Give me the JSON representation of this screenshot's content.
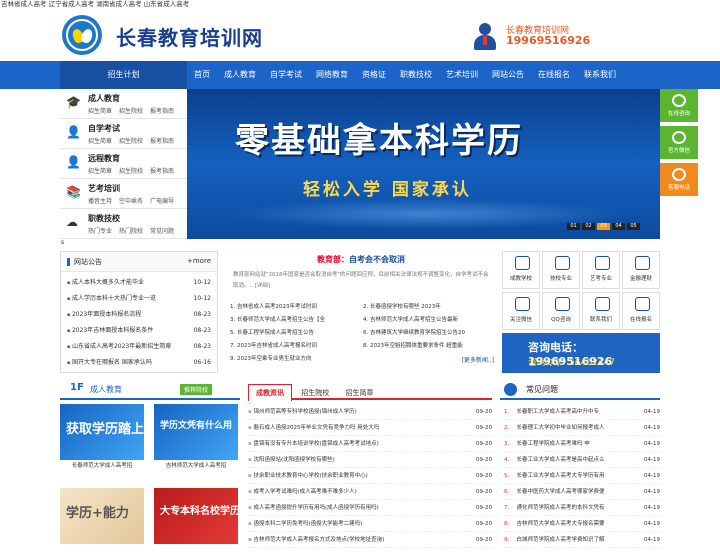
{
  "top_strip": "吉林省成人高考 辽宁省成人高考 湖南省成人高考 山东省成人高考",
  "header": {
    "site_name": "长春教育培训网",
    "contact_name": "长春教育培训网",
    "contact_phone": "19969516926"
  },
  "nav": {
    "left_label": "招生计划",
    "items": [
      "首页",
      "成人教育",
      "自学考试",
      "网络教育",
      "资格证",
      "职教技校",
      "艺术培训",
      "网站公告",
      "在线报名",
      "联系我们"
    ]
  },
  "side_menu": [
    {
      "title": "成人教育",
      "icon": "graduation-cap-icon",
      "subs": [
        "招生简章",
        "招生院校",
        "报考指南"
      ]
    },
    {
      "title": "自学考试",
      "icon": "person-icon",
      "subs": [
        "招生简章",
        "招生院校",
        "报考指南"
      ]
    },
    {
      "title": "远程教育",
      "icon": "person-icon",
      "subs": [
        "招生简章",
        "招生院校",
        "报考指南"
      ]
    },
    {
      "title": "艺考培训",
      "icon": "books-icon",
      "subs": [
        "播音主持",
        "空中乘务",
        "广电编导"
      ]
    },
    {
      "title": "职教技校",
      "icon": "cloud-icon",
      "subs": [
        "热门专业",
        "热门院校",
        "常见问题"
      ]
    }
  ],
  "banner": {
    "headline": "零基础拿本科学历",
    "subline": "轻松入学  国家承认",
    "pages": [
      "01",
      "02",
      "03",
      "04",
      "05"
    ],
    "active_page": "03"
  },
  "float_bar": [
    "在线咨询",
    "官方微信",
    "客服电话"
  ],
  "tiny_s": "s",
  "notice": {
    "title": "网站公告",
    "more": "+more",
    "items": [
      {
        "t": "成人本科大概多久才能毕业",
        "d": "10-12"
      },
      {
        "t": "成人学历本科十大热门专业一览",
        "d": "10-12"
      },
      {
        "t": "2023年面授本科报名流程",
        "d": "08-23"
      },
      {
        "t": "2023年吉林面授本科报名条件",
        "d": "08-23"
      },
      {
        "t": "山东省成人高考2023年最新招生简章",
        "d": "08-23"
      },
      {
        "t": "国开大专在哪报名 国家承认吗",
        "d": "06-16"
      }
    ]
  },
  "news": {
    "headline_prefix": "教育部：",
    "headline": "自考会不会取消",
    "summary": "教育部网站就\"2018年国家是否会取消自考\"的问题回应称，目前相关法律法规不调整变化，自学考试不会取消。...[详细]",
    "items": [
      "1. 吉林省成人高考2023年考试时间",
      "2. 长春函授学校有哪些 2023年",
      "3. 长春师范大学成人高考招生公告【全",
      "4. 吉林师范大学成人高考招生公告最新",
      "5. 长春工程学院成人高考招生公告",
      "6. 吉林建筑大学继续教育学院招生公告20",
      "7. 2023年吉林省成人高考报名时间",
      "8. 2023年空姐招聘体重要求条件 超重能",
      "9. 2023年空乘专业男生就业方向",
      ""
    ],
    "more": "[更多新闻..]"
  },
  "icon_grid": [
    {
      "label": "成教学校",
      "icon": "chat-icon"
    },
    {
      "label": "技校专业",
      "icon": "pencil-icon"
    },
    {
      "label": "艺考专业",
      "icon": "person-icon"
    },
    {
      "label": "金融理财",
      "icon": "home-icon"
    },
    {
      "label": "关注微信",
      "icon": "wechat-icon"
    },
    {
      "label": "QQ咨询",
      "icon": "qq-icon"
    },
    {
      "label": "联系我们",
      "icon": "contact-icon"
    },
    {
      "label": "在线报名",
      "icon": "form-icon"
    }
  ],
  "hotline": {
    "phone": "咨询电话：19969516926",
    "qq": "咨询QQ：56462447"
  },
  "section_1f": {
    "num": "1F",
    "name": "成人教育",
    "tag": "推荐院校",
    "cards": [
      {
        "overlay": "获取学历踏上",
        "caption": "长春师范大学成人高考招"
      },
      {
        "overlay": "学历文凭有什么用",
        "caption": "吉林师范大学成人高考招"
      },
      {
        "overlay": "学历+能力",
        "caption": ""
      },
      {
        "overlay": "大专本科名校学历",
        "caption": ""
      }
    ]
  },
  "mid_tabs": [
    "成教资讯",
    "招生院校",
    "招生简章"
  ],
  "mid_list": [
    {
      "t": "锦州师范高等专科学校函授(锦州成人学历)",
      "d": "09-20"
    },
    {
      "t": "磐石成人函授2025年毕业文凭有竞争力吗 用处大吗",
      "d": "09-20"
    },
    {
      "t": "盘锦有没有专升本培训学校(盘锦成人高考考试地点)",
      "d": "09-20"
    },
    {
      "t": "沈阳函授站(沈阳函授学校有哪些)",
      "d": "09-20"
    },
    {
      "t": "扶余职业技术教育中心学校(扶余职业教育中心)",
      "d": "09-20"
    },
    {
      "t": "成考入学考试难吗(成人高考难不难多少人)",
      "d": "09-20"
    },
    {
      "t": "成人高考函授提升学历有用吗(成人函授学历有用吗)",
      "d": "09-20"
    },
    {
      "t": "函授本科二学历免考吗(函授大学能考二建吗)",
      "d": "09-20"
    },
    {
      "t": "吉林师范大学成人高考报名方式及地点(学校地址查询)",
      "d": "09-20"
    }
  ],
  "faq": {
    "title": "常见问题",
    "items": [
      {
        "n": "1.",
        "t": "长春职工大学成人高考高中升中专",
        "d": "04-19"
      },
      {
        "n": "2.",
        "t": "长春理工大学初中毕业如何报考成人",
        "d": "04-19"
      },
      {
        "n": "3.",
        "t": "长春工程学院成人高考难吗 申",
        "d": "04-19"
      },
      {
        "n": "4.",
        "t": "长春工业大学成人高考是高中起点么",
        "d": "04-19"
      },
      {
        "n": "5.",
        "t": "长春工业大学成人高考大专学历有用",
        "d": "04-19"
      },
      {
        "n": "6.",
        "t": "长春中医药大学成人高考哪家学费便",
        "d": "04-19"
      },
      {
        "n": "7.",
        "t": "通化师范学院成人高考的本科文凭有",
        "d": "04-19"
      },
      {
        "n": "8.",
        "t": "吉林师范大学成人高考大专报名需要",
        "d": "04-19"
      },
      {
        "n": "9.",
        "t": "白城师范学院成人高考学费知识了解",
        "d": "04-19"
      }
    ]
  }
}
